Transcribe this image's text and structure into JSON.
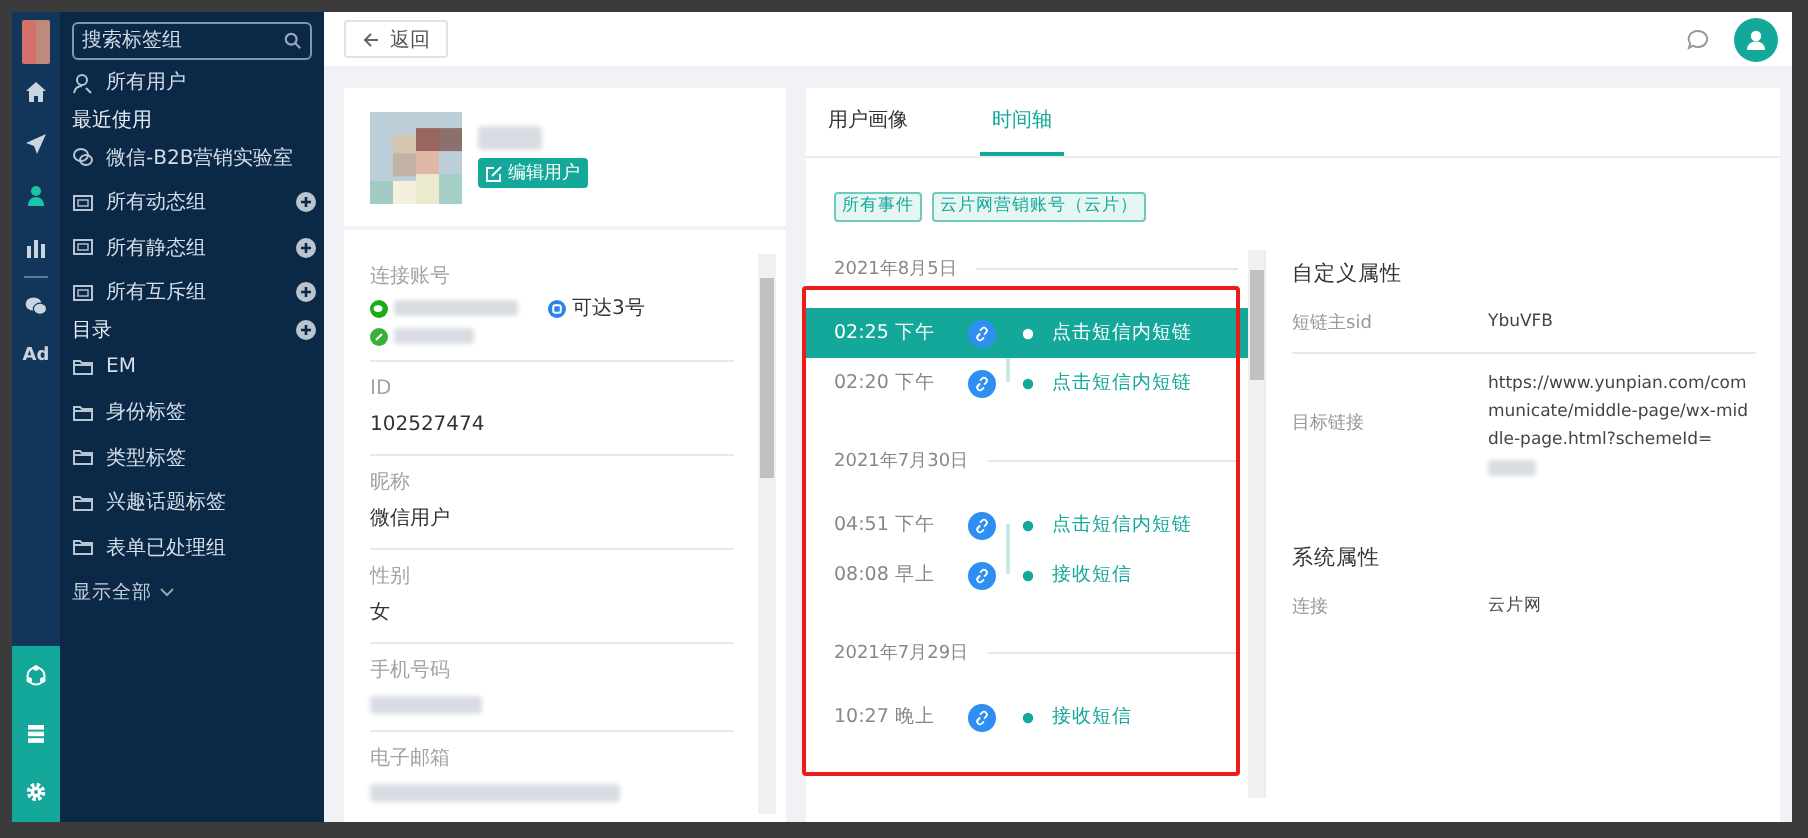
{
  "rail": {
    "items": [
      {
        "kind": "home",
        "selected": false
      },
      {
        "kind": "send",
        "selected": false
      },
      {
        "kind": "user",
        "selected": true
      },
      {
        "kind": "chart",
        "selected": false
      },
      {
        "kind": "divider",
        "selected": false
      },
      {
        "kind": "chat",
        "selected": false
      },
      {
        "kind": "text",
        "label": "Ad",
        "selected": false
      }
    ],
    "bottom": [
      {
        "kind": "network"
      },
      {
        "kind": "list"
      },
      {
        "kind": "gear"
      }
    ]
  },
  "sidebar": {
    "search": {
      "placeholder": "搜索标签组"
    },
    "items": [
      {
        "kind": "users",
        "label": "所有用户"
      },
      {
        "kind": "heading",
        "label": "最近使用"
      },
      {
        "kind": "chat",
        "label": "微信-B2B营销实验室"
      },
      {
        "kind": "group",
        "label": "所有动态组"
      },
      {
        "kind": "group",
        "label": "所有静态组"
      },
      {
        "kind": "group",
        "label": "所有互斥组"
      },
      {
        "kind": "heading-add",
        "label": "目录"
      },
      {
        "kind": "folder",
        "label": "EM"
      },
      {
        "kind": "folder",
        "label": "身份标签"
      },
      {
        "kind": "folder",
        "label": "类型标签"
      },
      {
        "kind": "folder",
        "label": "兴趣话题标签"
      },
      {
        "kind": "folder",
        "label": "表单已处理组"
      },
      {
        "kind": "more",
        "label": "显示全部"
      }
    ]
  },
  "topbar": {
    "back_button": "返回"
  },
  "profile": {
    "edit_button": "编辑用户",
    "fields": [
      {
        "kind": "accounts",
        "label": "连接账号",
        "badge": "可达3号"
      },
      {
        "kind": "text",
        "label": "ID",
        "value": "102527474"
      },
      {
        "kind": "text",
        "label": "昵称",
        "value": "微信用户"
      },
      {
        "kind": "text",
        "label": "性别",
        "value": "女"
      },
      {
        "kind": "blurred",
        "label": "手机号码"
      },
      {
        "kind": "blurred",
        "label": "电子邮箱"
      }
    ]
  },
  "tabs": [
    {
      "label": "用户画像",
      "selected": false
    },
    {
      "label": "时间轴",
      "selected": true
    }
  ],
  "filters": [
    "所有事件",
    "云片网营销账号（云片）"
  ],
  "timeline": [
    {
      "date": "2021年8月5日",
      "events": [
        {
          "time": "02:25 下午",
          "label": "点击短信内短链",
          "selected": true
        },
        {
          "time": "02:20 下午",
          "label": "点击短信内短链",
          "selected": false
        }
      ]
    },
    {
      "date": "2021年7月30日",
      "events": [
        {
          "time": "04:51 下午",
          "label": "点击短信内短链",
          "selected": false
        },
        {
          "time": "08:08 早上",
          "label": "接收短信",
          "selected": false
        }
      ]
    },
    {
      "date": "2021年7月29日",
      "events": [
        {
          "time": "10:27 晚上",
          "label": "接收短信",
          "selected": false
        }
      ]
    }
  ],
  "details": [
    {
      "title": "自定义属性",
      "rows": [
        {
          "label": "短链主sid",
          "value": "YbuVFB"
        },
        {
          "label": "目标链接",
          "value": "https://www.yunpian.com/communicate/middle-page/wx-middle-page.html?schemeId=",
          "blurred_tail": true
        }
      ]
    },
    {
      "title": "系统属性",
      "rows": [
        {
          "label": "连接",
          "value": "云片网"
        }
      ]
    }
  ]
}
